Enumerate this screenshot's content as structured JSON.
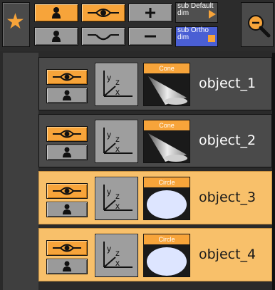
{
  "toolbar": {
    "sub_default_label": "sub Default dim",
    "sub_ortho_label": "sub Ortho dim"
  },
  "objects": [
    {
      "name": "object_1",
      "geometry": "Cone",
      "style": "dark"
    },
    {
      "name": "object_2",
      "geometry": "Cone",
      "style": "dark"
    },
    {
      "name": "object_3",
      "geometry": "Circle",
      "style": "light"
    },
    {
      "name": "object_4",
      "geometry": "Circle",
      "style": "light"
    }
  ],
  "colors": {
    "accent_orange": "#f7a43a",
    "row_dark": "#4a4a4a",
    "row_light": "#f8c06a",
    "ortho_blue": "#4a5fd4"
  }
}
